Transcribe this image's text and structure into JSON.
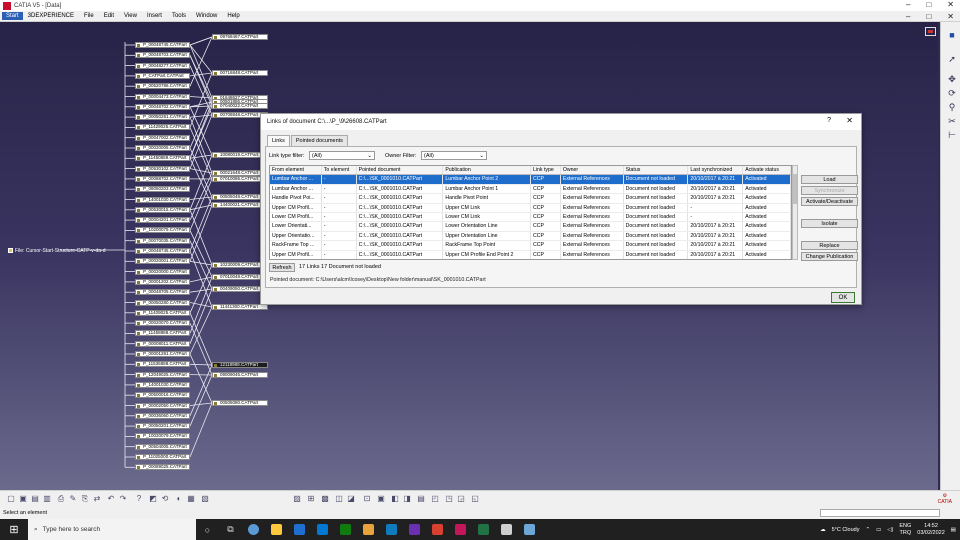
{
  "window": {
    "title": "CATIA V5 - [Data]",
    "controls": [
      "–",
      "□",
      "✕"
    ]
  },
  "menu": {
    "items": [
      "Start",
      "3DEXPERIENCE",
      "File",
      "Edit",
      "View",
      "Insert",
      "Tools",
      "Window",
      "Help"
    ],
    "doc_controls": [
      "–",
      "□",
      "✕"
    ]
  },
  "tree": {
    "root_label": "File: Cursor-Start-Structure-CATP-v-da-d",
    "left_nodes": [
      "P_00048745.CATPart",
      "P_00048703.CATPart",
      "P_00048277.CATPart",
      "P_CATPart.CATPart",
      "P_00520786.CATPart",
      "P_00004473.CATPart",
      "P_00048702.CATPart",
      "P_00050281.CATPart",
      "P_11429025.CATPart",
      "P_00047002.CATPart",
      "P_00020005.CATPart",
      "P_11450889.CATPart",
      "P_00530102.CATPart",
      "P_00088702.CATPart",
      "P_08050203.CATPart",
      "P_14001030.CATPart",
      "P_00530015.CATPart",
      "P_00004201.CATPart",
      "P_10200079.CATPart",
      "P_00070035.CATPart",
      "P_00048745.CATPart",
      "P_00020001.CATPart",
      "P_00020000.CATPart",
      "P_00001202.CATPart",
      "P_00048705.CATPart",
      "P_00050280.CATPart",
      "P_11409025.CATPart",
      "P_00020070.CATPart",
      "P_11458888.CATPart",
      "P_00008011.CATPart",
      "P_00001281.CATPart",
      "P_11535888.CATPart",
      "P_12049025.CATPart",
      "P_14001030.CATPart",
      "P_00500016.CATPart",
      "P_00002050.CATPart",
      "P_00036060.CATPart",
      "P_00050201.CATPart",
      "P_10020079.CATPart",
      "P_00504005.CATPart",
      "P_11025000.CATPart",
      "P_00089025.CATPart"
    ],
    "right_nodes": [
      "09768467.CATPart",
      "00716848.CATPart",
      "01648627.CATPart",
      "00501886.CATPart",
      "07040022.CATPart",
      "00708848.CATPart",
      "10080019.CATPart",
      "00021648.CATPart",
      "07010086.CATPart",
      "00505048.CATPart",
      "14400021.CATPart",
      "10230009.CATPart",
      "07010048.CATPart",
      "00409050.CATPart",
      "11441300.CATPart",
      "12118989.CATPart",
      "09009045.CATPart",
      "00505080.CATPart"
    ],
    "selected_right_index": 15
  },
  "dialog": {
    "title": "Links of document C:\\...\\P_\\9\\26608.CATPart",
    "help": "?",
    "close": "✕",
    "tabs": [
      "Links",
      "Pointed documents"
    ],
    "link_type_filter_label": "Link type filter:",
    "link_type_filter_value": "(All)",
    "owner_filter_label": "Owner Filter:",
    "owner_filter_value": "(All)",
    "columns": [
      "From element",
      "To element",
      "Pointed document",
      "Publication",
      "Link type",
      "Owner",
      "Status",
      "Last synchronized",
      "Activate status"
    ],
    "rows": [
      [
        "Lumbar Anchor ...",
        "-",
        "C:\\...\\SK_0001010.CATPart",
        "Lumbar Anchor Point 2",
        "CCP",
        "External References",
        "Document not loaded",
        "20/10/2017 à 20:21",
        "Activated"
      ],
      [
        "Lumbar Anchor ...",
        "-",
        "C:\\...\\SK_0001010.CATPart",
        "Lumbar Anchor Point 1",
        "CCP",
        "External References",
        "Document not loaded",
        "20/10/2017 à 20:21",
        "Activated"
      ],
      [
        "Handle Pivot Poi...",
        "-",
        "C:\\...\\SK_0001010.CATPart",
        "Handle Pivot Point",
        "CCP",
        "External References",
        "Document not loaded",
        "20/10/2017 à 20:21",
        "Activated"
      ],
      [
        "Upper CM Profil...",
        "-",
        "C:\\...\\SK_0001010.CATPart",
        "Upper CM Link",
        "CCP",
        "External References",
        "Document not loaded",
        "-",
        "Activated"
      ],
      [
        "Lower CM Profil...",
        "-",
        "C:\\...\\SK_0001010.CATPart",
        "Lower CM Link",
        "CCP",
        "External References",
        "Document not loaded",
        "-",
        "Activated"
      ],
      [
        "Lower Orientati...",
        "-",
        "C:\\...\\SK_0001010.CATPart",
        "Lower Orientation Line",
        "CCP",
        "External References",
        "Document not loaded",
        "20/10/2017 à 20:21",
        "Activated"
      ],
      [
        "Upper Orientatio...",
        "-",
        "C:\\...\\SK_0001010.CATPart",
        "Upper Orientation Line",
        "CCP",
        "External References",
        "Document not loaded",
        "20/10/2017 à 20:21",
        "Activated"
      ],
      [
        "RackFrame Top ...",
        "-",
        "C:\\...\\SK_0001010.CATPart",
        "RackFrame Top Point",
        "CCP",
        "External References",
        "Document not loaded",
        "20/10/2017 à 20:21",
        "Activated"
      ],
      [
        "Upper CM Profil...",
        "-",
        "C:\\...\\SK_0001010.CATPart",
        "Upper CM Profile End Point 2",
        "CCP",
        "External References",
        "Document not loaded",
        "20/10/2017 à 20:21",
        "Activated"
      ]
    ],
    "buttons": {
      "load": "Load",
      "synchronize": "Synchronize",
      "activate": "Activate/Deactivate",
      "isolate": "Isolate",
      "replace": "Replace",
      "change_publication": "Change Publication"
    },
    "refresh": "Refresh",
    "summary": "17 Links  17 Document not loaded",
    "pointed_document": "Pointed document:  C:\\Users\\alcm\\Icosey\\Desktop\\New folder\\manual\\SK_0001010.CATPart",
    "ok": "OK"
  },
  "status": {
    "text": "Select an element"
  },
  "taskbar": {
    "search_placeholder": "Type here to search",
    "weather": "5°C  Cloudy",
    "lang_top": "ENG",
    "lang_bottom": "TRQ",
    "time": "14:52",
    "date": "03/02/2022",
    "app_colors": [
      "#5b9bd5",
      "#ffc83d",
      "#1f6fd1",
      "#0078d4",
      "#107c10",
      "#e8a33d",
      "#0f7bbd",
      "#6b2fb1",
      "#d8412f",
      "#c2185b",
      "#217346",
      "#cfcfcf",
      "#6ea6d8"
    ]
  },
  "colors": {
    "workspace_top": "#272347",
    "selection": "#1e6ccc"
  }
}
